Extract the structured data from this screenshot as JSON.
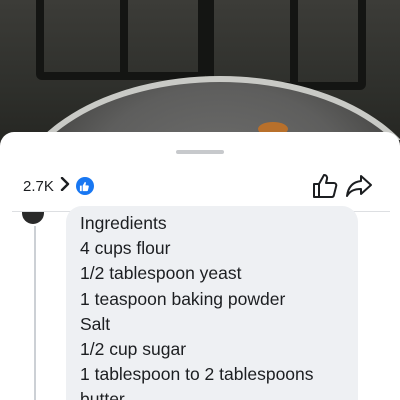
{
  "video": {
    "description_icon": "stove-pan-video-frame"
  },
  "reactions": {
    "count": "2.7K",
    "chevron": "›",
    "badge_icon": "like-icon"
  },
  "actions": {
    "like_icon": "thumbs-up-icon",
    "share_icon": "share-icon"
  },
  "comment": {
    "lines": [
      "Ingredients",
      "4 cups flour",
      "1/2 tablespoon yeast",
      "1 teaspoon baking powder",
      "Salt",
      "1/2 cup sugar",
      "1 tablespoon to 2 tablespoons",
      "butter"
    ]
  },
  "colors": {
    "accent": "#1877f2",
    "bubble": "#eef0f3",
    "text": "#1c1e21"
  }
}
